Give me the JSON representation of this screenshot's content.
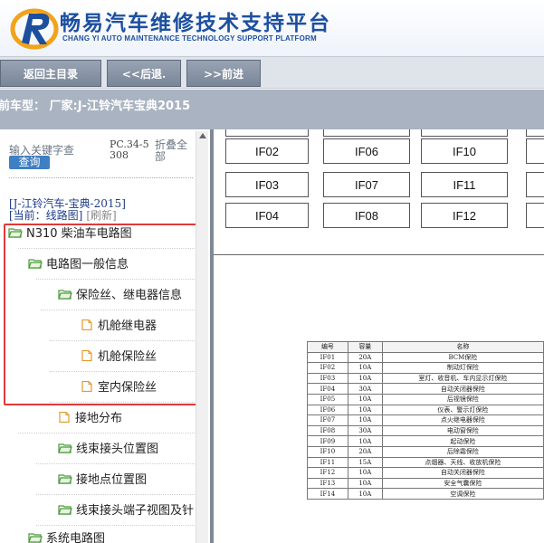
{
  "header": {
    "title": "畅易汽车维修技术支持平台",
    "subtitle": "CHANG YI AUTO MAINTENANCE TECHNOLOGY SUPPORT PLATFORM",
    "brand_color": "#1d4f9e"
  },
  "nav": {
    "home": "返回主目录",
    "back": "<<后退.",
    "forward": ">>前进"
  },
  "model_bar": {
    "text": "前车型： 厂家:J-江铃汽车宝典2015"
  },
  "sidebar": {
    "search_label": "输入关键字查",
    "search_button": "查询",
    "pc_label": "PC.34-5308",
    "collapse_all": "折叠全部",
    "brand_line": "[J-江铃汽车-宝典-2015]",
    "current_label": "[当前：线路图]",
    "refresh": "[刷新]",
    "tree": [
      {
        "label": "N310 柴油车电路图",
        "icon": "folder-open-icon"
      },
      {
        "label": "电路图一般信息",
        "icon": "folder-open-icon"
      },
      {
        "label": "保险丝、继电器信息",
        "icon": "folder-open-icon"
      },
      {
        "label": "机舱继电器",
        "icon": "document-icon"
      },
      {
        "label": "机舱保险丝",
        "icon": "document-icon"
      },
      {
        "label": "室内保险丝",
        "icon": "document-icon"
      },
      {
        "label": "接地分布",
        "icon": "document-icon"
      },
      {
        "label": "线束接头位置图",
        "icon": "folder-open-icon"
      },
      {
        "label": "接地点位置图",
        "icon": "folder-open-icon"
      },
      {
        "label": "线束接头端子视图及针",
        "icon": "folder-open-icon"
      },
      {
        "label": "系统电路图",
        "icon": "folder-open-icon"
      }
    ],
    "highlight_color": "#e0393a"
  },
  "fuse_grid": [
    [
      "IF02",
      "IF06",
      "IF10"
    ],
    [
      "IF03",
      "IF07",
      "IF11"
    ],
    [
      "IF04",
      "IF08",
      "IF12"
    ]
  ],
  "fuse_table": {
    "headers": [
      "编号",
      "容量",
      "名称"
    ],
    "rows": [
      [
        "IF01",
        "20A",
        "BCM保险"
      ],
      [
        "IF02",
        "10A",
        "制动灯保险"
      ],
      [
        "IF03",
        "10A",
        "室灯、收音机、车内显示灯保险"
      ],
      [
        "IF04",
        "30A",
        "自动关闭器保险"
      ],
      [
        "IF05",
        "10A",
        "后视镜保险"
      ],
      [
        "IF06",
        "10A",
        "仪表、警示灯保险"
      ],
      [
        "IF07",
        "10A",
        "点火继电器保险"
      ],
      [
        "IF08",
        "30A",
        "电动窗保险"
      ],
      [
        "IF09",
        "10A",
        "起动保险"
      ],
      [
        "IF10",
        "20A",
        "后除霜保险"
      ],
      [
        "IF11",
        "15A",
        "点烟器、天线、收放机保险"
      ],
      [
        "IF12",
        "10A",
        "自动关闭器保险"
      ],
      [
        "IF13",
        "10A",
        "安全气囊保险"
      ],
      [
        "IF14",
        "10A",
        "空调保险"
      ]
    ]
  }
}
